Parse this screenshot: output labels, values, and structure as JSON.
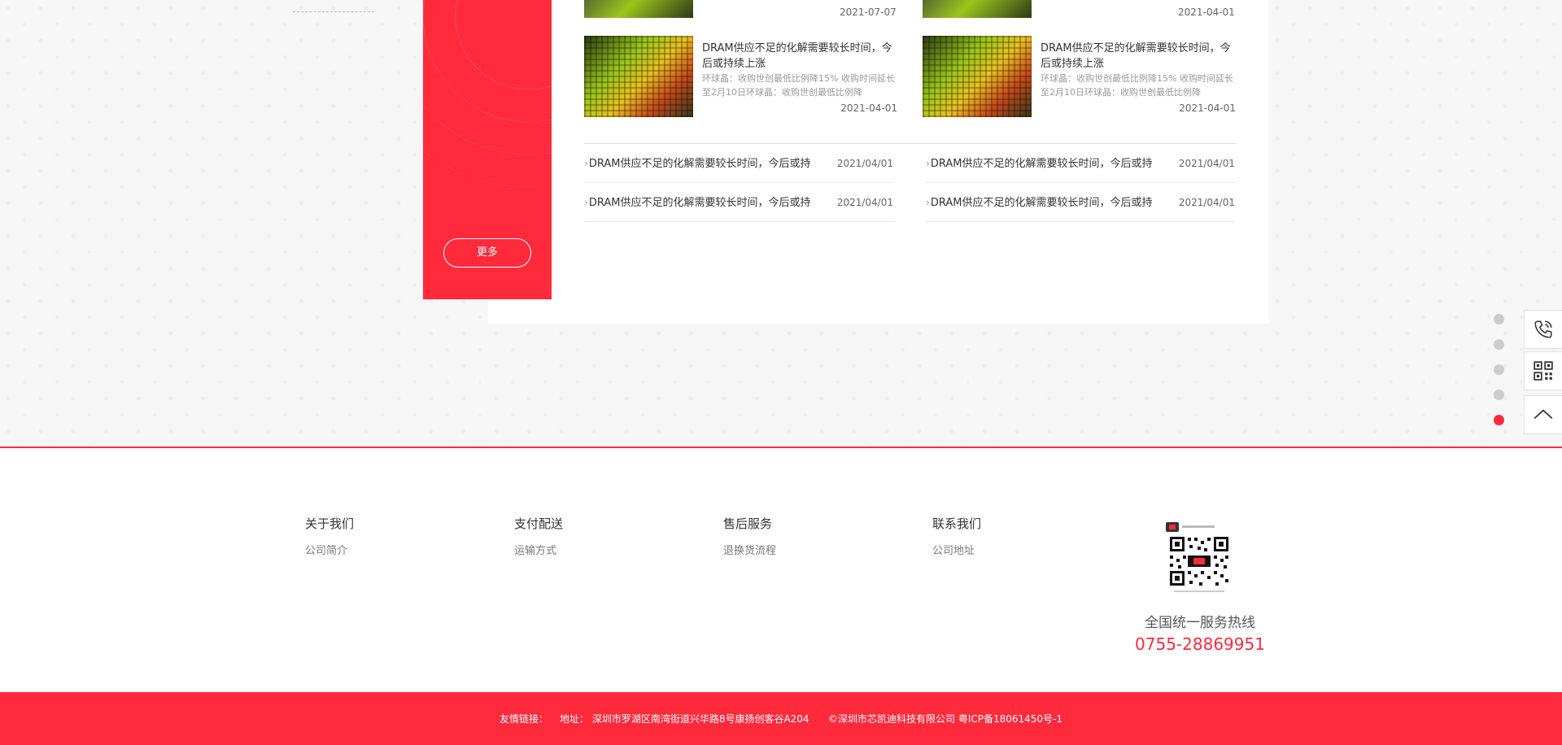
{
  "news_top": {
    "left_date": "2021-07-07",
    "right_date": "2021-04-01"
  },
  "news_cards": [
    {
      "title": "DRAM供应不足的化解需要较长时间，今后或持续上涨",
      "desc": "环球晶：收购世创最低比例降15% 收购时间延长至2月10日环球晶：收购世创最低比例降",
      "date": "2021-04-01"
    },
    {
      "title": "DRAM供应不足的化解需要较长时间，今后或持续上涨",
      "desc": "环球晶：收购世创最低比例降15% 收购时间延长至2月10日环球晶：收购世创最低比例降",
      "date": "2021-04-01"
    }
  ],
  "news_list": [
    {
      "title": "DRAM供应不足的化解需要较长时间，今后或持",
      "date": "2021/04/01"
    },
    {
      "title": "DRAM供应不足的化解需要较长时间，今后或持",
      "date": "2021/04/01"
    },
    {
      "title": "DRAM供应不足的化解需要较长时间，今后或持",
      "date": "2021/04/01"
    },
    {
      "title": "DRAM供应不足的化解需要较长时间，今后或持",
      "date": "2021/04/01"
    }
  ],
  "more_label": "更多",
  "arrow_glyph": "›",
  "footer": {
    "columns": [
      {
        "heading": "关于我们",
        "link": "公司简介"
      },
      {
        "heading": "支付配送",
        "link": "运输方式"
      },
      {
        "heading": "售后服务",
        "link": "退换货流程"
      },
      {
        "heading": "联系我们",
        "link": "公司地址"
      }
    ],
    "hotline_label": "全国统一服务热线",
    "hotline_number": "0755-28869951"
  },
  "bottom_bar": {
    "friend_links": "友情链接：",
    "address": "地址：  深圳市罗湖区南湾街道兴华路8号康扬创客谷A204",
    "copyright": "©深圳市芯凯迪科技有限公司 粤ICP备18061450号-1"
  },
  "side_tools": {
    "icons": [
      "phone-icon",
      "qrcode-icon",
      "back-to-top-icon"
    ],
    "dots_total": 5,
    "dots_active_index": 4
  },
  "colors": {
    "brand_red": "#ff2a3c"
  }
}
